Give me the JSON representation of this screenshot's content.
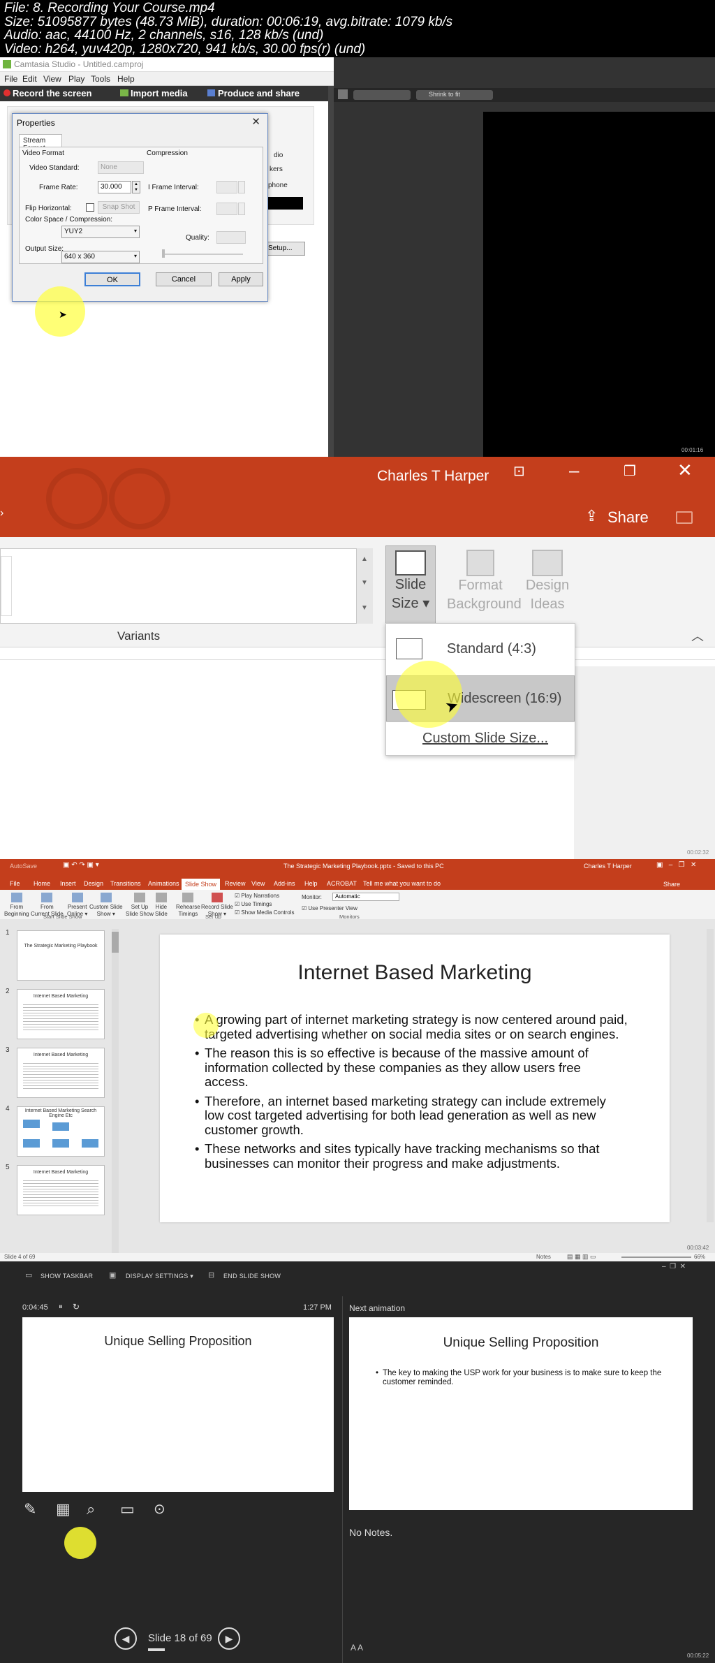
{
  "file_info": {
    "line1": "File: 8. Recording Your Course.mp4",
    "line2": "Size: 51095877 bytes (48.73 MiB), duration: 00:06:19, avg.bitrate: 1079 kb/s",
    "line3": "Audio: aac, 44100 Hz, 2 channels, s16, 128 kb/s (und)",
    "line4": "Video: h264, yuv420p, 1280x720, 941 kb/s, 30.00 fps(r) (und)"
  },
  "frame1": {
    "window_title": "Camtasia Studio - Untitled.camproj",
    "menu": [
      "File",
      "Edit",
      "View",
      "Play",
      "Tools",
      "Help"
    ],
    "toolbar": [
      "Record the screen",
      "Import media",
      "Produce and share"
    ],
    "right_toolbar": "Shrink to fit",
    "partial_labels": [
      "dio",
      "kers",
      "phone",
      "Setup..."
    ],
    "dialog": {
      "title": "Properties",
      "close": "✕",
      "tab": "Stream Format",
      "video_format_label": "Video Format",
      "compression_label": "Compression",
      "video_standard_label": "Video Standard:",
      "video_standard_value": "None",
      "frame_rate_label": "Frame Rate:",
      "frame_rate_value": "30.000",
      "flip_label": "Flip Horizontal:",
      "snapshot_label": "Snap Shot",
      "colorspace_label": "Color Space / Compression:",
      "colorspace_value": "YUY2",
      "output_size_label": "Output Size:",
      "output_size_value": "640 x 360",
      "iframe_label": "I Frame Interval:",
      "pframe_label": "P Frame Interval:",
      "quality_label": "Quality:",
      "ok": "OK",
      "cancel": "Cancel",
      "apply": "Apply"
    },
    "timestamp": "00:01:16"
  },
  "frame2": {
    "user": "Charles T Harper",
    "share": "Share",
    "variants_label": "Variants",
    "slide_size": [
      "Slide",
      "Size"
    ],
    "format_background": [
      "Format",
      "Background"
    ],
    "design_ideas": [
      "Design",
      "Ideas"
    ],
    "menu_items": {
      "standard": "Standard (4:3)",
      "widescreen": "Widescreen (16:9)",
      "custom": "Custom Slide Size..."
    },
    "timestamp": "00:02:32"
  },
  "frame3": {
    "doc_title": "The Strategic Marketing Playbook.pptx - Saved to this PC",
    "user": "Charles T Harper",
    "share": "Share",
    "autosave": "AutoSave",
    "tabs": [
      "File",
      "Home",
      "Insert",
      "Design",
      "Transitions",
      "Animations",
      "Slide Show",
      "Review",
      "View",
      "Add-ins",
      "Help",
      "ACROBAT",
      "Tell me what you want to do"
    ],
    "ribbon": {
      "from_beginning": [
        "From",
        "Beginning"
      ],
      "from_current": [
        "From",
        "Current Slide"
      ],
      "present_online": [
        "Present",
        "Online ▾"
      ],
      "custom_show": [
        "Custom Slide",
        "Show ▾"
      ],
      "setup_show": [
        "Set Up",
        "Slide Show"
      ],
      "hide_slide": [
        "Hide",
        "Slide"
      ],
      "rehearse": [
        "Rehearse",
        "Timings"
      ],
      "record_show": [
        "Record Slide",
        "Show ▾"
      ],
      "play_narrations": "Play Narrations",
      "use_timings": "Use Timings",
      "show_media_controls": "Show Media Controls",
      "monitor_label": "Monitor:",
      "monitor_value": "Automatic",
      "use_presenter_view": "Use Presenter View",
      "group_start": "Start Slide Show",
      "group_setup": "Set Up",
      "group_monitors": "Monitors"
    },
    "thumbs": [
      {
        "num": "1",
        "title": "The Strategic Marketing Playbook"
      },
      {
        "num": "2",
        "title": "Internet Based Marketing"
      },
      {
        "num": "3",
        "title": "Internet Based Marketing"
      },
      {
        "num": "4",
        "title": "Internet Based Marketing Search Engine Etc"
      },
      {
        "num": "5",
        "title": "Internet Based Marketing"
      }
    ],
    "slide_title": "Internet Based Marketing",
    "bullets": [
      "A growing part of internet marketing strategy is now centered around paid, targeted advertising whether on social media sites or on search engines.",
      "The reason this is so effective is because of the massive amount of information collected by these companies as they allow users free access.",
      "Therefore, an internet based marketing strategy can include extremely low cost targeted advertising for both lead generation as well as new customer growth.",
      "These networks and sites typically have tracking mechanisms so that businesses can monitor their progress and make adjustments."
    ],
    "status_left": "Slide 4 of 69",
    "status_notes": "Notes",
    "status_zoom": "66%",
    "timestamp": "00:03:42"
  },
  "frame4": {
    "show_taskbar": "SHOW TASKBAR",
    "display_settings": "DISPLAY SETTINGS ▾",
    "end_slide_show": "END SLIDE SHOW",
    "timer": "0:04:45",
    "clock": "1:27 PM",
    "next_animation": "Next animation",
    "current_title": "Unique Selling Proposition",
    "next_title": "Unique Selling Proposition",
    "next_bullet": "The key to making the USP work for your business is to make sure to keep the customer reminded.",
    "no_notes": "No Notes.",
    "slide_counter": "Slide 18 of 69",
    "timestamp": "00:05:22"
  }
}
